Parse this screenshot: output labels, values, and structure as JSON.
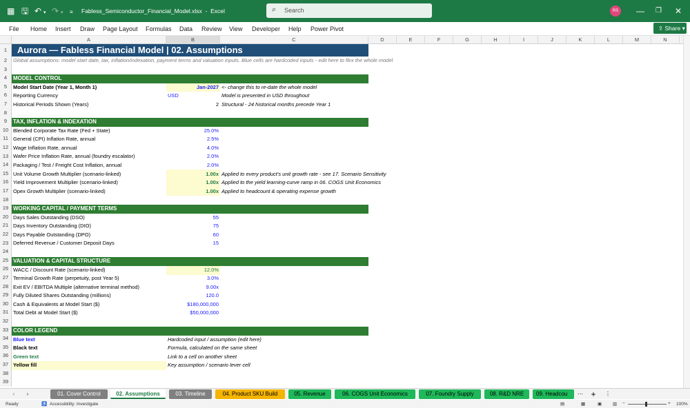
{
  "titlebar": {
    "filename": "Fabless_Semiconductor_Financial_Model.xlsx",
    "app": "Excel",
    "search_placeholder": "Search",
    "avatar": "RS"
  },
  "menu": [
    "File",
    "Home",
    "Insert",
    "Draw",
    "Page Layout",
    "Formulas",
    "Data",
    "Review",
    "View",
    "Developer",
    "Help",
    "Power Pivot"
  ],
  "share_label": "Share",
  "columns": [
    "A",
    "B",
    "C",
    "D",
    "E",
    "F",
    "G",
    "H",
    "I",
    "J",
    "K",
    "L",
    "M",
    "N"
  ],
  "sheet": {
    "title": "Aurora — Fabless Financial Model  |  02. Assumptions",
    "subtitle": "Global assumptions: model start date, tax, inflation/indexation, payment terms and valuation inputs. Blue cells are hardcoded inputs - edit here to flex the whole model",
    "sec_model": "MODEL CONTROL",
    "r5a": "Model Start Date  (Year 1, Month 1)",
    "r5b": "Jan-2027",
    "r5c": "<- change this to re-date the whole model",
    "r6a": "Reporting Currency",
    "r6b": "USD",
    "r6c": "Model is presented in USD throughout",
    "r7a": "Historical Periods Shown (Years)",
    "r7b": "2",
    "r7c": "Structural - 24 historical months precede Year 1",
    "sec_tax": "TAX, INFLATION & INDEXATION",
    "r10a": "Blended Corporate Tax Rate (Fed + State)",
    "r10b": "25.0%",
    "r11a": "General (CPI) Inflation Rate, annual",
    "r11b": "2.5%",
    "r12a": "Wage Inflation Rate, annual",
    "r12b": "4.0%",
    "r13a": "Wafer Price Inflation Rate, annual (foundry escalator)",
    "r13b": "2.0%",
    "r14a": "Packaging / Test / Freight Cost Inflation, annual",
    "r14b": "2.0%",
    "r15a": "Unit Volume Growth Multiplier  (scenario-linked)",
    "r15b": "1.00x",
    "r15c": "Applied to every product's unit growth rate - see 17. Scenario Sensitivity",
    "r16a": "Yield Improvement Multiplier  (scenario-linked)",
    "r16b": "1.00x",
    "r16c": "Applied to the yield learning-curve ramp in 06. COGS Unit Economics",
    "r17a": "Opex Growth Multiplier  (scenario-linked)",
    "r17b": "1.00x",
    "r17c": "Applied to headcount & operating expense growth",
    "sec_wc": "WORKING CAPITAL / PAYMENT TERMS",
    "r20a": "Days Sales Outstanding (DSO)",
    "r20b": "55",
    "r21a": "Days Inventory Outstanding (DIO)",
    "r21b": "75",
    "r22a": "Days Payable Outstanding (DPO)",
    "r22b": "60",
    "r23a": "Deferred Revenue / Customer Deposit Days",
    "r23b": "15",
    "sec_val": "VALUATION & CAPITAL STRUCTURE",
    "r26a": "WACC / Discount Rate  (scenario-linked)",
    "r26b": "12.0%",
    "r27a": "Terminal Growth Rate  (perpetuity, post Year 5)",
    "r27b": "3.0%",
    "r28a": "Exit EV / EBITDA Multiple  (alternative terminal method)",
    "r28b": "9.00x",
    "r29a": "Fully Diluted Shares Outstanding (millions)",
    "r29b": "120.0",
    "r30a": "Cash & Equivalents at Model Start ($)",
    "r30b": "$180,000,000",
    "r31a": "Total Debt at Model Start ($)",
    "r31b": "$50,000,000",
    "sec_leg": "COLOR LEGEND",
    "r34a": "Blue text",
    "r34b": "Hardcoded input / assumption (edit here)",
    "r35a": "Black text",
    "r35b": "Formula, calculated on the same sheet",
    "r36a": "Green text",
    "r36b": "Link to a cell on another sheet",
    "r37a": "Yellow fill",
    "r37b": "Key assumption / scenario lever cell"
  },
  "tabs": [
    "01. Cover Control",
    "02. Assumptions",
    "03. Timeline",
    "04. Product SKU Build",
    "05. Revenue",
    "06. COGS Unit Economics",
    "07. Foundry Supply",
    "08. R&D NRE",
    "09. Headcou"
  ],
  "status": {
    "ready": "Ready",
    "accessibility": "Accessibility: Investigate",
    "zoom": "100%"
  },
  "colors": {
    "excel_green": "#1e7a45",
    "title_blue": "#1f4e79",
    "band_green": "#2e7d32",
    "input_blue": "#1a1aff",
    "yellow_fill": "#fdfbd0"
  }
}
